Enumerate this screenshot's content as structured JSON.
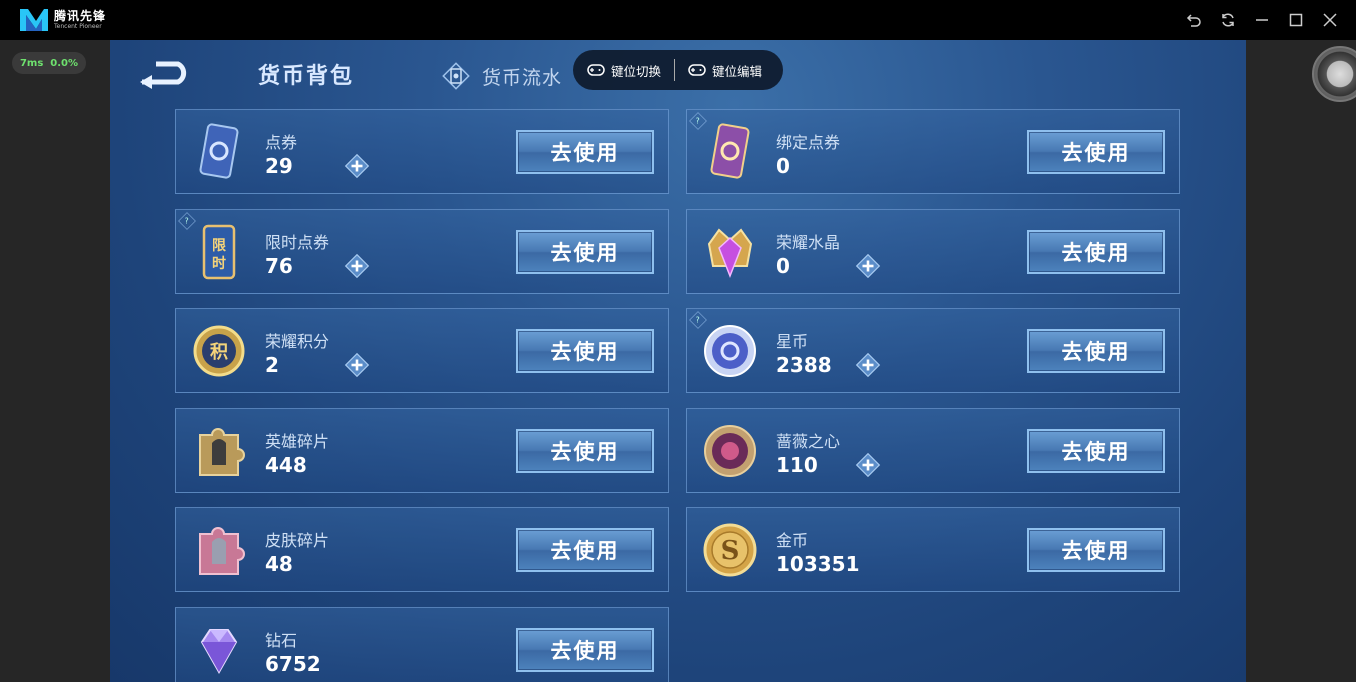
{
  "app": {
    "logo_cn": "腾讯先锋",
    "logo_en": "Tencent Pioneer",
    "perf_ms": "7ms",
    "perf_loss": "0.0%"
  },
  "header": {
    "title": "货币背包",
    "tab2_label": "货币流水",
    "key_switch": "键位切换",
    "key_edit": "键位编辑"
  },
  "use_label": "去使用",
  "left_cards": [
    {
      "name": "点券",
      "value": "29",
      "icon": "coupon-icon",
      "plus": true,
      "help": false
    },
    {
      "name": "限时点券",
      "value": "76",
      "icon": "limited-coupon-icon",
      "plus": true,
      "help": true
    },
    {
      "name": "荣耀积分",
      "value": "2",
      "icon": "glory-points-icon",
      "plus": true,
      "help": false
    },
    {
      "name": "英雄碎片",
      "value": "448",
      "icon": "hero-fragment-icon",
      "plus": false,
      "help": false
    },
    {
      "name": "皮肤碎片",
      "value": "48",
      "icon": "skin-fragment-icon",
      "plus": false,
      "help": false
    },
    {
      "name": "钻石",
      "value": "6752",
      "icon": "diamond-icon",
      "plus": false,
      "help": false
    }
  ],
  "right_cards": [
    {
      "name": "绑定点券",
      "value": "0",
      "icon": "bound-coupon-icon",
      "plus": false,
      "help": true
    },
    {
      "name": "荣耀水晶",
      "value": "0",
      "icon": "glory-crystal-icon",
      "plus": true,
      "help": false
    },
    {
      "name": "星币",
      "value": "2388",
      "icon": "star-coin-icon",
      "plus": true,
      "help": true
    },
    {
      "name": "蔷薇之心",
      "value": "110",
      "icon": "rose-heart-icon",
      "plus": true,
      "help": false
    },
    {
      "name": "金币",
      "value": "103351",
      "icon": "gold-coin-icon",
      "plus": false,
      "help": false
    }
  ],
  "help_mark": "?",
  "colors": {
    "accent": "#4879b3",
    "background": "#1e447a",
    "perf_text": "#6ee16e"
  }
}
